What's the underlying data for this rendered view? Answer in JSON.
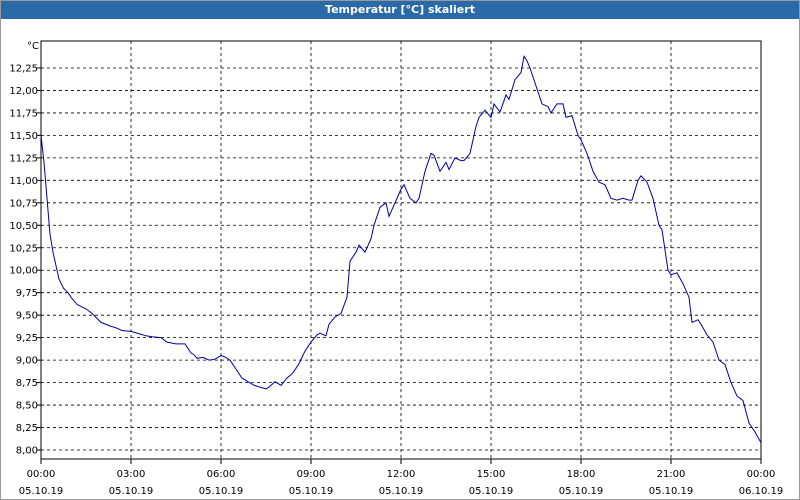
{
  "window": {
    "title": "Temperatur [°C] skaliert"
  },
  "chart_data": {
    "type": "line",
    "ylabel": "°C",
    "xlabel": "",
    "ylim": [
      7.9,
      12.55
    ],
    "xlim_hours": [
      0,
      24
    ],
    "grid": true,
    "line_color": "#0000a0",
    "y_ticks": [
      {
        "value": 8.0,
        "label": "8,00"
      },
      {
        "value": 8.25,
        "label": "8,25"
      },
      {
        "value": 8.5,
        "label": "8,50"
      },
      {
        "value": 8.75,
        "label": "8,75"
      },
      {
        "value": 9.0,
        "label": "9,00"
      },
      {
        "value": 9.25,
        "label": "9,25"
      },
      {
        "value": 9.5,
        "label": "9,50"
      },
      {
        "value": 9.75,
        "label": "9,75"
      },
      {
        "value": 10.0,
        "label": "10,00"
      },
      {
        "value": 10.25,
        "label": "10,25"
      },
      {
        "value": 10.5,
        "label": "10,50"
      },
      {
        "value": 10.75,
        "label": "10,75"
      },
      {
        "value": 11.0,
        "label": "11,00"
      },
      {
        "value": 11.25,
        "label": "11,25"
      },
      {
        "value": 11.5,
        "label": "11,50"
      },
      {
        "value": 11.75,
        "label": "11,75"
      },
      {
        "value": 12.0,
        "label": "12,00"
      },
      {
        "value": 12.25,
        "label": "12,25"
      }
    ],
    "x_ticks": [
      {
        "hour": 0,
        "time": "00:00",
        "date": "05.10.19"
      },
      {
        "hour": 3,
        "time": "03:00",
        "date": "05.10.19"
      },
      {
        "hour": 6,
        "time": "06:00",
        "date": "05.10.19"
      },
      {
        "hour": 9,
        "time": "09:00",
        "date": "05.10.19"
      },
      {
        "hour": 12,
        "time": "12:00",
        "date": "05.10.19"
      },
      {
        "hour": 15,
        "time": "15:00",
        "date": "05.10.19"
      },
      {
        "hour": 18,
        "time": "18:00",
        "date": "05.10.19"
      },
      {
        "hour": 21,
        "time": "21:00",
        "date": "05.10.19"
      },
      {
        "hour": 24,
        "time": "00:00",
        "date": "06.10.19"
      }
    ],
    "series": [
      {
        "x": [
          0.0,
          0.1,
          0.2,
          0.3,
          0.4,
          0.5,
          0.6,
          0.75,
          0.9,
          1.0,
          1.2,
          1.5,
          1.7,
          2.0,
          2.3,
          2.5,
          2.7,
          3.0,
          3.3,
          3.5,
          3.7,
          4.0,
          4.2,
          4.5,
          4.8,
          5.0,
          5.1,
          5.2,
          5.4,
          5.6,
          5.8,
          6.0,
          6.1,
          6.3,
          6.5,
          6.7,
          6.9,
          7.1,
          7.3,
          7.5,
          7.6,
          7.8,
          8.0,
          8.2,
          8.4,
          8.6,
          8.8,
          9.0,
          9.2,
          9.3,
          9.5,
          9.6,
          9.8,
          10.0,
          10.2,
          10.3,
          10.5,
          10.6,
          10.8,
          11.0,
          11.1,
          11.3,
          11.5,
          11.6,
          11.8,
          12.0,
          12.1,
          12.3,
          12.5,
          12.6,
          12.8,
          13.0,
          13.1,
          13.3,
          13.5,
          13.6,
          13.8,
          14.0,
          14.1,
          14.3,
          14.5,
          14.6,
          14.8,
          15.0,
          15.1,
          15.3,
          15.5,
          15.6,
          15.8,
          16.0,
          16.1,
          16.2,
          16.3,
          16.5,
          16.7,
          16.9,
          17.0,
          17.2,
          17.4,
          17.5,
          17.7,
          17.9,
          18.0,
          18.2,
          18.4,
          18.6,
          18.8,
          19.0,
          19.2,
          19.4,
          19.6,
          19.7,
          19.9,
          20.0,
          20.2,
          20.4,
          20.6,
          20.7,
          20.9,
          21.0,
          21.2,
          21.4,
          21.6,
          21.7,
          21.9,
          22.0,
          22.2,
          22.4,
          22.6,
          22.8,
          23.0,
          23.2,
          23.4,
          23.6,
          23.8,
          24.0
        ],
        "values": [
          11.5,
          11.2,
          10.8,
          10.4,
          10.2,
          10.05,
          9.9,
          9.8,
          9.75,
          9.7,
          9.62,
          9.57,
          9.52,
          9.42,
          9.38,
          9.36,
          9.33,
          9.32,
          9.29,
          9.27,
          9.26,
          9.25,
          9.2,
          9.18,
          9.18,
          9.08,
          9.06,
          9.02,
          9.03,
          9.0,
          9.01,
          9.05,
          9.04,
          9.0,
          8.9,
          8.8,
          8.76,
          8.72,
          8.7,
          8.68,
          8.7,
          8.76,
          8.72,
          8.8,
          8.86,
          8.96,
          9.1,
          9.2,
          9.28,
          9.3,
          9.27,
          9.4,
          9.48,
          9.52,
          9.7,
          10.1,
          10.2,
          10.28,
          10.2,
          10.35,
          10.5,
          10.7,
          10.75,
          10.6,
          10.75,
          10.9,
          10.95,
          10.8,
          10.75,
          10.8,
          11.1,
          11.3,
          11.28,
          11.1,
          11.2,
          11.12,
          11.25,
          11.22,
          11.22,
          11.3,
          11.6,
          11.7,
          11.78,
          11.7,
          11.85,
          11.76,
          11.95,
          11.9,
          12.12,
          12.2,
          12.38,
          12.33,
          12.25,
          12.05,
          11.85,
          11.82,
          11.75,
          11.85,
          11.85,
          11.7,
          11.72,
          11.5,
          11.45,
          11.3,
          11.1,
          10.98,
          10.95,
          10.8,
          10.78,
          10.8,
          10.78,
          10.78,
          11.0,
          11.05,
          10.98,
          10.8,
          10.5,
          10.45,
          10.0,
          9.95,
          9.97,
          9.85,
          9.7,
          9.42,
          9.45,
          9.4,
          9.28,
          9.2,
          9.0,
          8.95,
          8.75,
          8.6,
          8.55,
          8.3,
          8.2,
          8.08
        ]
      }
    ]
  }
}
